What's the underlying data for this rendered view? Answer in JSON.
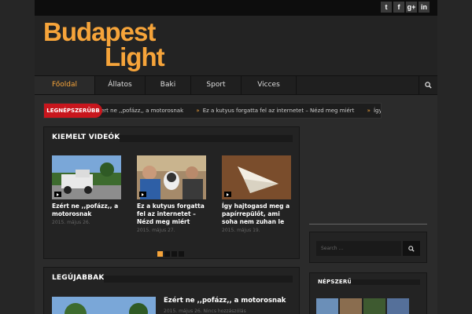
{
  "social": [
    {
      "icon": "twitter-icon",
      "glyph": "t"
    },
    {
      "icon": "facebook-icon",
      "glyph": "f"
    },
    {
      "icon": "google-plus-icon",
      "glyph": "g+"
    },
    {
      "icon": "linkedin-icon",
      "glyph": "in"
    }
  ],
  "logo": {
    "line1": "Budapest",
    "line2": "Light"
  },
  "nav": {
    "items": [
      "Főoldal",
      "Állatos",
      "Baki",
      "Sport",
      "Vicces"
    ],
    "active": 0
  },
  "ticker": {
    "badge": "LEGNÉPSZERŰBB",
    "items": [
      "ert ne ,,pofázz,, a motorosnak",
      "Ez a kutyus forgatta fel az internetet – Nézd meg miért",
      "Így hajtoga"
    ]
  },
  "featured": {
    "title": "KIEMELT VIDEÓK",
    "videos": [
      {
        "title": "Ezért ne ,,pofázz,, a motorosnak",
        "date": "2015. május 26."
      },
      {
        "title": "Ez a kutyus forgatta fel az internetet – Nézd meg miért",
        "date": "2015. május 27."
      },
      {
        "title": "Így hajtogasd meg a papírrepülőt, ami soha nem zuhan le",
        "date": "2015. május 19."
      }
    ],
    "dots": 4,
    "active_dot": 0
  },
  "sidebar": {
    "search_placeholder": "Search ...",
    "popular_title": "NÉPSZERŰ"
  },
  "latest": {
    "title": "LEGÚJABBAK",
    "items": [
      {
        "title": "Ezért ne ,,pofázz,, a motorosnak",
        "meta": "2015. május 26.   Nincs hozzászólás"
      }
    ]
  }
}
